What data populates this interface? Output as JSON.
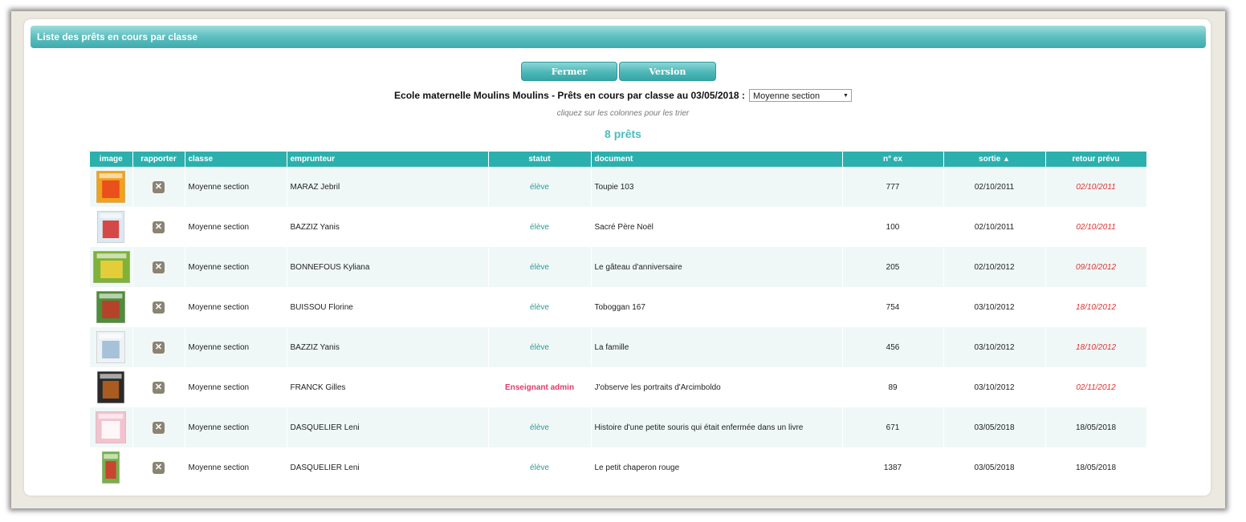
{
  "title": "Liste des prêts en cours par classe",
  "buttons": {
    "close": "Fermer",
    "print": "Version imprimable"
  },
  "heading": "Ecole maternelle Moulins Moulins - Prêts en cours par classe au 03/05/2018 :",
  "class_select": {
    "selected": "Moyenne section"
  },
  "hint": "cliquez sur les colonnes pour les trier",
  "count": "8 prêts",
  "columns": {
    "image": "image",
    "rapporter": "rapporter",
    "classe": "classe",
    "emprunteur": "emprunteur",
    "statut": "statut",
    "document": "document",
    "nex": "n° ex",
    "sortie": "sortie",
    "retour": "retour prévu"
  },
  "colors": {
    "accent": "#2cb0ae",
    "late": "#e03030",
    "admin": "#e23a6a"
  },
  "rows": [
    {
      "classe": "Moyenne section",
      "emprunteur": "MARAZ Jebril",
      "statut": "élève",
      "document": "Toupie 103",
      "nex": "777",
      "sortie": "02/10/2011",
      "retour": "02/10/2011"
    },
    {
      "classe": "Moyenne section",
      "emprunteur": "BAZZIZ Yanis",
      "statut": "élève",
      "document": "Sacré Père Noël",
      "nex": "100",
      "sortie": "02/10/2011",
      "retour": "02/10/2011"
    },
    {
      "classe": "Moyenne section",
      "emprunteur": "BONNEFOUS Kyliana",
      "statut": "élève",
      "document": "Le gâteau d'anniversaire",
      "nex": "205",
      "sortie": "02/10/2012",
      "retour": "09/10/2012"
    },
    {
      "classe": "Moyenne section",
      "emprunteur": "BUISSOU Florine",
      "statut": "élève",
      "document": "Toboggan 167",
      "nex": "754",
      "sortie": "03/10/2012",
      "retour": "18/10/2012"
    },
    {
      "classe": "Moyenne section",
      "emprunteur": "BAZZIZ Yanis",
      "statut": "élève",
      "document": "La famille",
      "nex": "456",
      "sortie": "03/10/2012",
      "retour": "18/10/2012"
    },
    {
      "classe": "Moyenne section",
      "emprunteur": "FRANCK Gilles",
      "statut": "Enseignant admin",
      "document": "J'observe les portraits d'Arcimboldo",
      "nex": "89",
      "sortie": "03/10/2012",
      "retour": "02/11/2012"
    },
    {
      "classe": "Moyenne section",
      "emprunteur": "DASQUELIER Leni",
      "statut": "élève",
      "document": "Histoire d'une petite souris qui était enfermée dans un livre",
      "nex": "671",
      "sortie": "03/05/2018",
      "retour": "18/05/2018"
    },
    {
      "classe": "Moyenne section",
      "emprunteur": "DASQUELIER Leni",
      "statut": "élève",
      "document": "Le petit chaperon rouge",
      "nex": "1387",
      "sortie": "03/05/2018",
      "retour": "18/05/2018"
    }
  ]
}
